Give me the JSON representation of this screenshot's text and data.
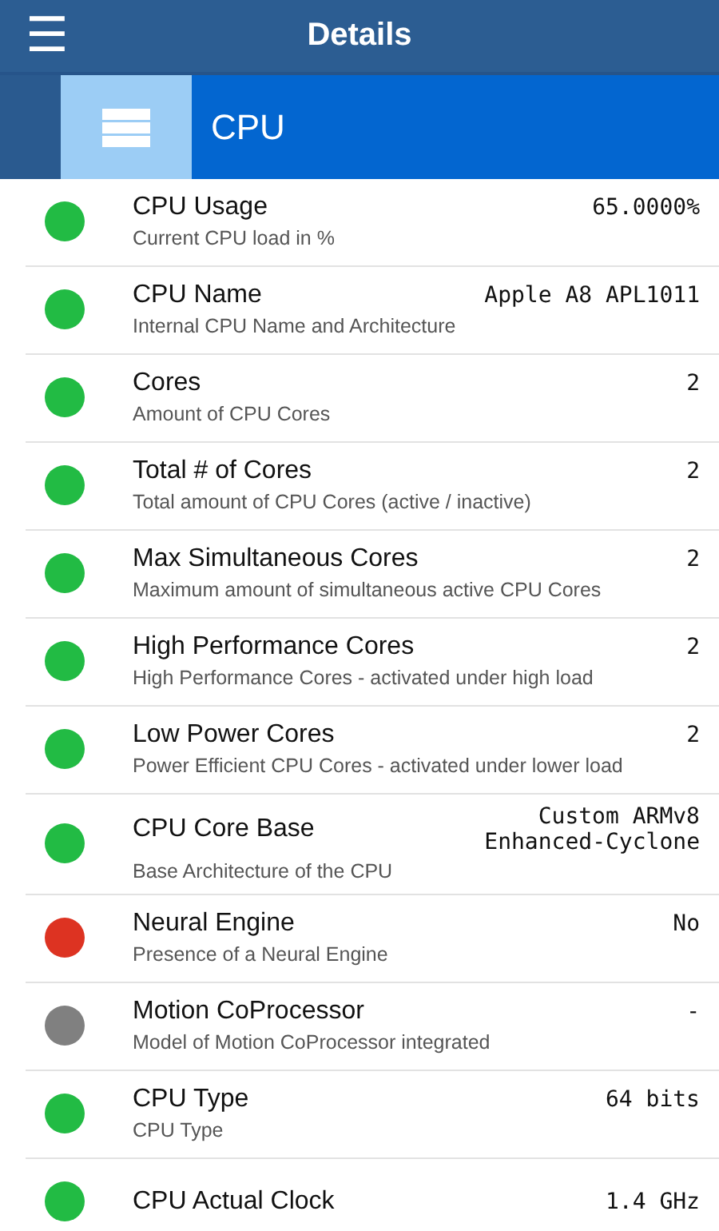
{
  "header": {
    "title": "Details",
    "menu_icon": "☰"
  },
  "section": {
    "title": "CPU"
  },
  "rows": [
    {
      "title": "CPU Usage",
      "subtitle": "Current CPU load in %",
      "value": "65.0000%",
      "color": "#22bb44"
    },
    {
      "title": "CPU Name",
      "subtitle": "Internal CPU Name and Architecture",
      "value": "Apple A8 APL1011",
      "color": "#22bb44"
    },
    {
      "title": "Cores",
      "subtitle": "Amount of CPU Cores",
      "value": "2",
      "color": "#22bb44"
    },
    {
      "title": "Total # of Cores",
      "subtitle": "Total amount of CPU Cores (active / inactive)",
      "value": "2",
      "color": "#22bb44"
    },
    {
      "title": "Max Simultaneous Cores",
      "subtitle": "Maximum amount of simultaneous active CPU Cores",
      "value": "2",
      "color": "#22bb44"
    },
    {
      "title": "High Performance Cores",
      "subtitle": "High Performance Cores - activated under high load",
      "value": "2",
      "color": "#22bb44"
    },
    {
      "title": "Low Power Cores",
      "subtitle": "Power Efficient CPU Cores - activated under lower load",
      "value": "2",
      "color": "#22bb44"
    },
    {
      "title": "CPU Core Base",
      "subtitle": "Base Architecture of the CPU",
      "value": "Custom ARMv8\nEnhanced-Cyclone",
      "color": "#22bb44"
    },
    {
      "title": "Neural Engine",
      "subtitle": "Presence of a Neural Engine",
      "value": "No",
      "color": "#dd3322"
    },
    {
      "title": "Motion CoProcessor",
      "subtitle": "Model of Motion CoProcessor integrated",
      "value": "-",
      "color": "#808080"
    },
    {
      "title": "CPU Type",
      "subtitle": "CPU Type",
      "value": "64 bits",
      "color": "#22bb44"
    },
    {
      "title": "CPU Actual Clock",
      "value": "1.4 GHz",
      "color": "#22bb44"
    }
  ]
}
